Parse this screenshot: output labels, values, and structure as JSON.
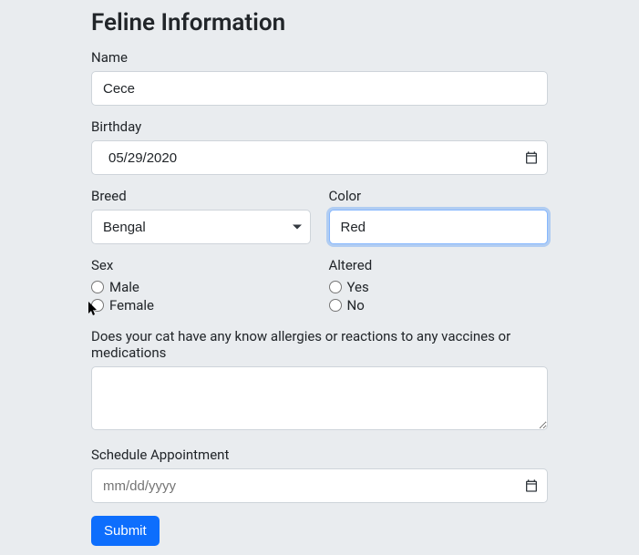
{
  "heading": "Feline Information",
  "name": {
    "label": "Name",
    "value": "Cece"
  },
  "birthday": {
    "label": "Birthday",
    "value": "05/29/2020"
  },
  "breed": {
    "label": "Breed",
    "selected": "Bengal"
  },
  "color": {
    "label": "Color",
    "value": "Red"
  },
  "sex": {
    "label": "Sex",
    "options": {
      "male": "Male",
      "female": "Female"
    }
  },
  "altered": {
    "label": "Altered",
    "options": {
      "yes": "Yes",
      "no": "No"
    }
  },
  "allergies": {
    "label": "Does your cat have any know allergies or reactions to any vaccines or medications",
    "value": ""
  },
  "appointment": {
    "label": "Schedule Appointment",
    "placeholder": "mm/dd/yyyy",
    "value": ""
  },
  "submit": {
    "label": "Submit"
  }
}
